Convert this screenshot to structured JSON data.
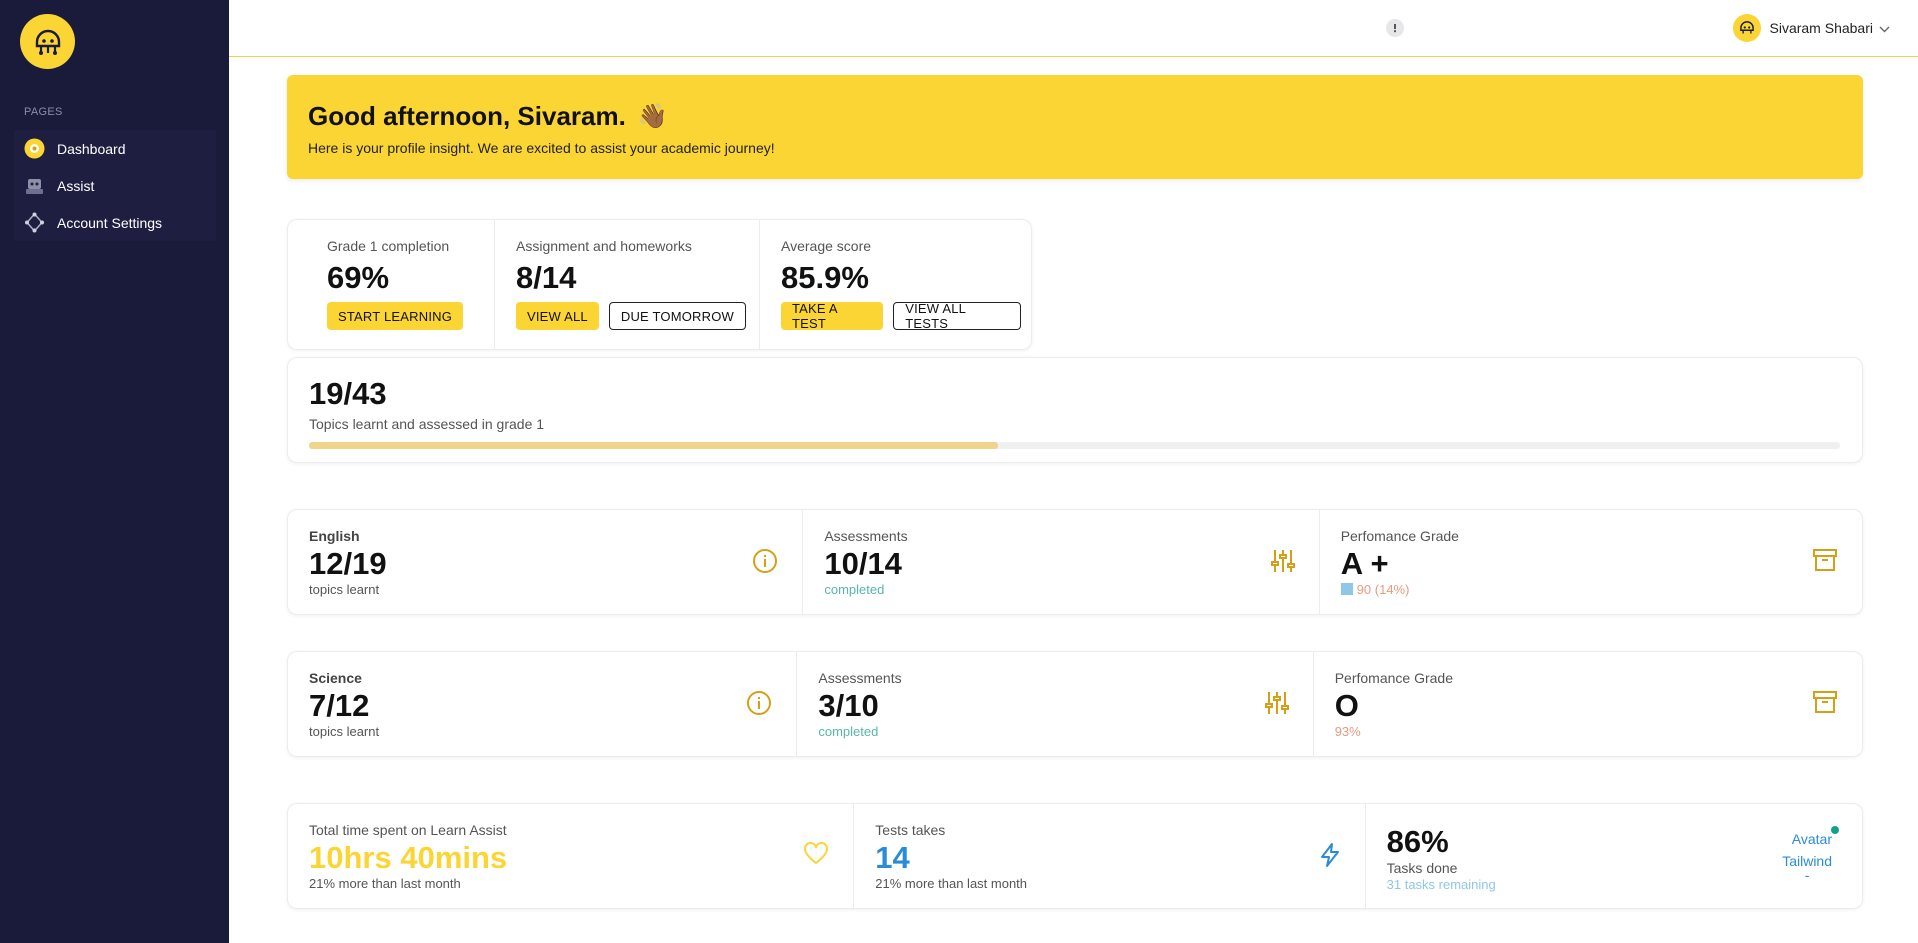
{
  "sidebar": {
    "section_label": "PAGES",
    "items": [
      {
        "label": "Dashboard"
      },
      {
        "label": "Assist"
      },
      {
        "label": "Account Settings"
      }
    ]
  },
  "topbar": {
    "user_name": "Sivaram Shabari"
  },
  "banner": {
    "title": "Good afternoon, Sivaram.",
    "emoji": "👋🏾",
    "subtitle": "Here is your profile insight. We are excited to assist your academic journey!"
  },
  "stats": {
    "completion": {
      "label": "Grade 1 completion",
      "value": "69%",
      "button": "START LEARNING"
    },
    "assignments": {
      "label": "Assignment and homeworks",
      "value": "8/14",
      "button1": "VIEW ALL",
      "button2": "DUE TOMORROW"
    },
    "score": {
      "label": "Average score",
      "value": "85.9%",
      "button1": "TAKE A TEST",
      "button2": "VIEW ALL TESTS"
    }
  },
  "topics": {
    "value": "19/43",
    "label": "Topics learnt and assessed in grade 1",
    "progress_fraction": 0.45
  },
  "english": {
    "subject": "English",
    "topics_value": "12/19",
    "topics_sub": "topics learnt",
    "assess_label": "Assessments",
    "assess_value": "10/14",
    "assess_sub": "completed",
    "grade_label": "Perfomance Grade",
    "grade_value": "A +",
    "grade_sub": "90 (14%)"
  },
  "science": {
    "subject": "Science",
    "topics_value": "7/12",
    "topics_sub": "topics learnt",
    "assess_label": "Assessments",
    "assess_value": "3/10",
    "assess_sub": "completed",
    "grade_label": "Perfomance Grade",
    "grade_value": "O",
    "grade_sub": "93%"
  },
  "bottom": {
    "time_label": "Total time spent on Learn Assist",
    "time_value": "10hrs 40mins",
    "time_sub": "21% more than last month",
    "tests_label": "Tests takes",
    "tests_value": "14",
    "tests_sub": "21% more than last month",
    "tasks_value": "86%",
    "tasks_label": "Tasks done",
    "tasks_sub": "31 tasks remaining",
    "link1": "Avatar",
    "link2": "Tailwind",
    "link3": "-"
  },
  "colors": {
    "accent": "#fbd533",
    "sidebar": "#1a1b3a",
    "icon_gold": "#d4a017",
    "blue": "#2a8cd6"
  }
}
